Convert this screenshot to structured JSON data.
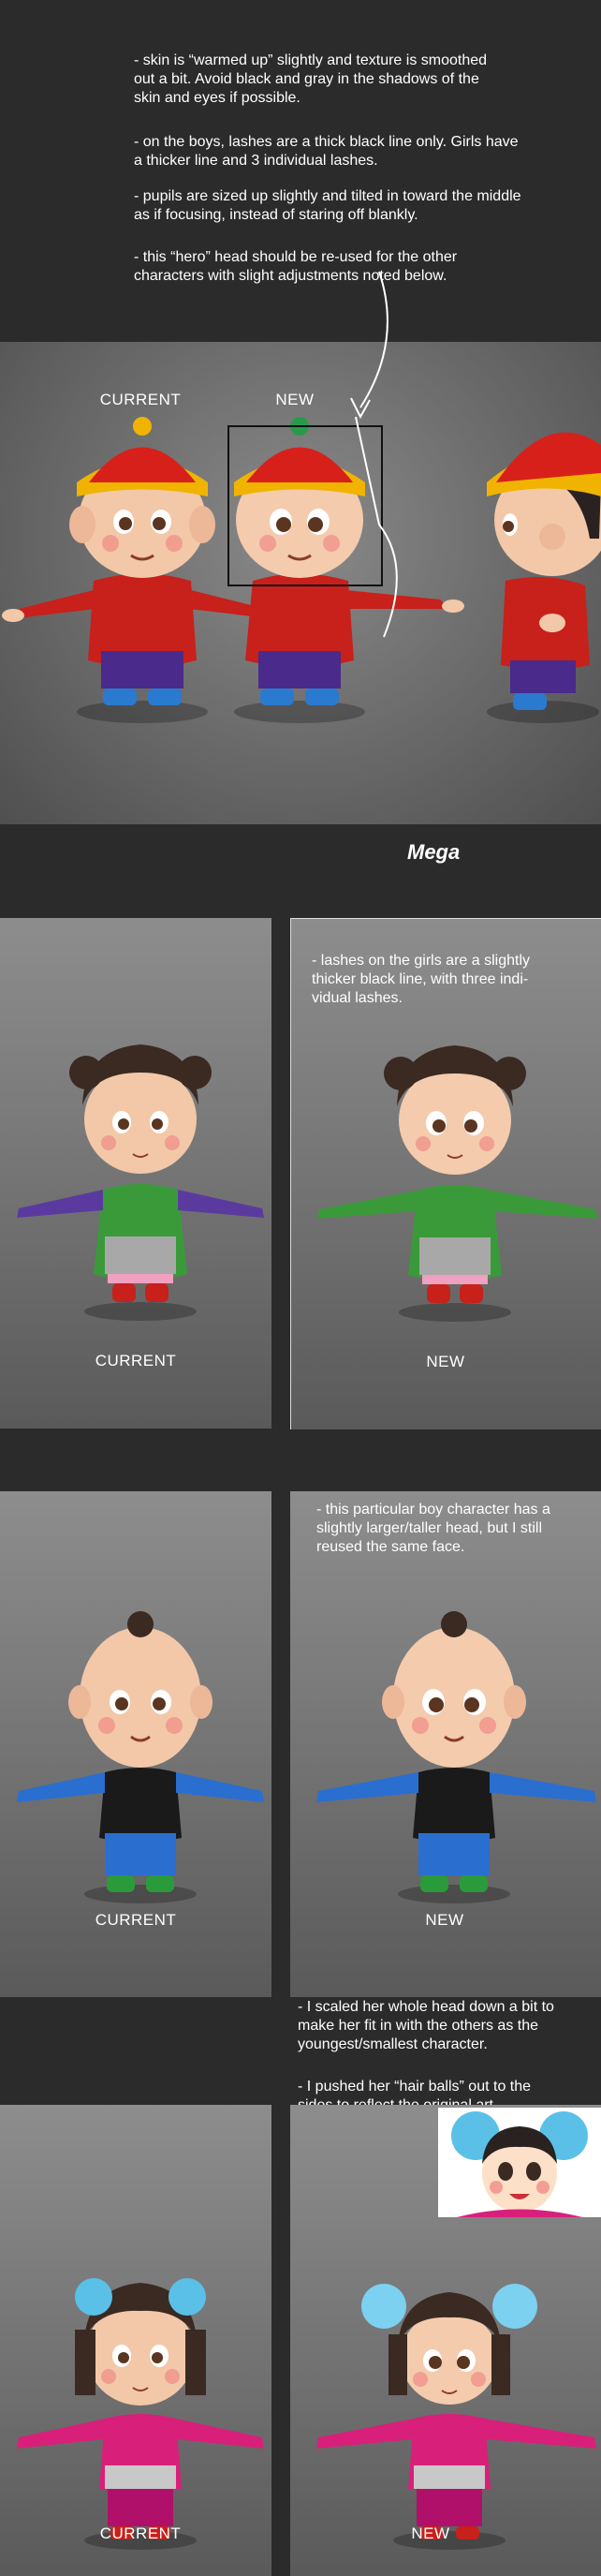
{
  "notes": {
    "intro": [
      "- skin is “warmed up” slightly and texture is smoothed out a bit.  Avoid black and gray in  the shadows of the skin and eyes if possible.",
      "- on the boys, lashes are a thick black line only. Girls have a thicker line and 3 individual lashes.",
      "- pupils are sized up slightly and tilted in toward the middle as if focusing, instead of staring off blankly.",
      "- this “hero” head should be re-used for the other characters with slight adjustments noted below."
    ],
    "girl_lashes": "- lashes on the girls are a slightly thicker black line, with three indi-vidual lashes.",
    "boy_head": "- this particular boy character has a slightly larger/taller head, but I still reused the same face.",
    "scale_head": "- I scaled her whole head down a bit to make her fit in with the others as the youngest/smallest character.",
    "hair_balls": "- I pushed her “hair balls” out to the sides to reflect the original art."
  },
  "section1": {
    "current_label": "CURRENT",
    "new_label": "NEW"
  },
  "section_title": "Mega",
  "section2": {
    "current_label": "CURRENT",
    "new_label": "NEW"
  },
  "section3": {
    "current_label": "CURRENT",
    "new_label": "NEW"
  },
  "section4": {
    "current_label": "CURRENT",
    "new_label": "NEW"
  },
  "colors": {
    "background": "#2b2b2b",
    "studio_gray": "#7a7a7a",
    "text": "#ffffff",
    "boy_red": "#c8201a",
    "hat_gold": "#f0b400",
    "girl_green": "#3a9a3a",
    "girl_purple": "#5b3aa0",
    "boy_blue": "#2a6fd0",
    "girl_pink": "#d8207a",
    "hair_blue": "#5ac0e8"
  }
}
